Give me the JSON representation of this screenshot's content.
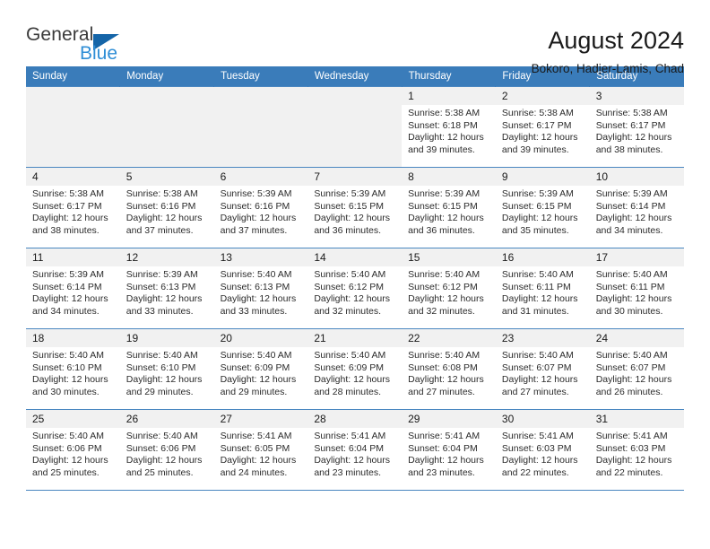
{
  "brand": {
    "name_top": "General",
    "name_bottom": "Blue",
    "triangle_color": "#1565a8",
    "blue_color": "#2f8ed6"
  },
  "header": {
    "title": "August 2024",
    "location": "Bokoro, Hadjer-Lamis, Chad"
  },
  "theme": {
    "header_bg": "#3a7cba",
    "row_border": "#4a87c0",
    "daynum_bg": "#f1f1f1"
  },
  "calendar": {
    "weekdays": [
      "Sunday",
      "Monday",
      "Tuesday",
      "Wednesday",
      "Thursday",
      "Friday",
      "Saturday"
    ],
    "weeks": [
      [
        {
          "day": "",
          "sunrise": "",
          "sunset": "",
          "daylight_line1": "",
          "daylight_line2": "",
          "empty": true
        },
        {
          "day": "",
          "sunrise": "",
          "sunset": "",
          "daylight_line1": "",
          "daylight_line2": "",
          "empty": true
        },
        {
          "day": "",
          "sunrise": "",
          "sunset": "",
          "daylight_line1": "",
          "daylight_line2": "",
          "empty": true
        },
        {
          "day": "",
          "sunrise": "",
          "sunset": "",
          "daylight_line1": "",
          "daylight_line2": "",
          "empty": true
        },
        {
          "day": "1",
          "sunrise": "Sunrise: 5:38 AM",
          "sunset": "Sunset: 6:18 PM",
          "daylight_line1": "Daylight: 12 hours",
          "daylight_line2": "and 39 minutes.",
          "empty": false
        },
        {
          "day": "2",
          "sunrise": "Sunrise: 5:38 AM",
          "sunset": "Sunset: 6:17 PM",
          "daylight_line1": "Daylight: 12 hours",
          "daylight_line2": "and 39 minutes.",
          "empty": false
        },
        {
          "day": "3",
          "sunrise": "Sunrise: 5:38 AM",
          "sunset": "Sunset: 6:17 PM",
          "daylight_line1": "Daylight: 12 hours",
          "daylight_line2": "and 38 minutes.",
          "empty": false
        }
      ],
      [
        {
          "day": "4",
          "sunrise": "Sunrise: 5:38 AM",
          "sunset": "Sunset: 6:17 PM",
          "daylight_line1": "Daylight: 12 hours",
          "daylight_line2": "and 38 minutes.",
          "empty": false
        },
        {
          "day": "5",
          "sunrise": "Sunrise: 5:38 AM",
          "sunset": "Sunset: 6:16 PM",
          "daylight_line1": "Daylight: 12 hours",
          "daylight_line2": "and 37 minutes.",
          "empty": false
        },
        {
          "day": "6",
          "sunrise": "Sunrise: 5:39 AM",
          "sunset": "Sunset: 6:16 PM",
          "daylight_line1": "Daylight: 12 hours",
          "daylight_line2": "and 37 minutes.",
          "empty": false
        },
        {
          "day": "7",
          "sunrise": "Sunrise: 5:39 AM",
          "sunset": "Sunset: 6:15 PM",
          "daylight_line1": "Daylight: 12 hours",
          "daylight_line2": "and 36 minutes.",
          "empty": false
        },
        {
          "day": "8",
          "sunrise": "Sunrise: 5:39 AM",
          "sunset": "Sunset: 6:15 PM",
          "daylight_line1": "Daylight: 12 hours",
          "daylight_line2": "and 36 minutes.",
          "empty": false
        },
        {
          "day": "9",
          "sunrise": "Sunrise: 5:39 AM",
          "sunset": "Sunset: 6:15 PM",
          "daylight_line1": "Daylight: 12 hours",
          "daylight_line2": "and 35 minutes.",
          "empty": false
        },
        {
          "day": "10",
          "sunrise": "Sunrise: 5:39 AM",
          "sunset": "Sunset: 6:14 PM",
          "daylight_line1": "Daylight: 12 hours",
          "daylight_line2": "and 34 minutes.",
          "empty": false
        }
      ],
      [
        {
          "day": "11",
          "sunrise": "Sunrise: 5:39 AM",
          "sunset": "Sunset: 6:14 PM",
          "daylight_line1": "Daylight: 12 hours",
          "daylight_line2": "and 34 minutes.",
          "empty": false
        },
        {
          "day": "12",
          "sunrise": "Sunrise: 5:39 AM",
          "sunset": "Sunset: 6:13 PM",
          "daylight_line1": "Daylight: 12 hours",
          "daylight_line2": "and 33 minutes.",
          "empty": false
        },
        {
          "day": "13",
          "sunrise": "Sunrise: 5:40 AM",
          "sunset": "Sunset: 6:13 PM",
          "daylight_line1": "Daylight: 12 hours",
          "daylight_line2": "and 33 minutes.",
          "empty": false
        },
        {
          "day": "14",
          "sunrise": "Sunrise: 5:40 AM",
          "sunset": "Sunset: 6:12 PM",
          "daylight_line1": "Daylight: 12 hours",
          "daylight_line2": "and 32 minutes.",
          "empty": false
        },
        {
          "day": "15",
          "sunrise": "Sunrise: 5:40 AM",
          "sunset": "Sunset: 6:12 PM",
          "daylight_line1": "Daylight: 12 hours",
          "daylight_line2": "and 32 minutes.",
          "empty": false
        },
        {
          "day": "16",
          "sunrise": "Sunrise: 5:40 AM",
          "sunset": "Sunset: 6:11 PM",
          "daylight_line1": "Daylight: 12 hours",
          "daylight_line2": "and 31 minutes.",
          "empty": false
        },
        {
          "day": "17",
          "sunrise": "Sunrise: 5:40 AM",
          "sunset": "Sunset: 6:11 PM",
          "daylight_line1": "Daylight: 12 hours",
          "daylight_line2": "and 30 minutes.",
          "empty": false
        }
      ],
      [
        {
          "day": "18",
          "sunrise": "Sunrise: 5:40 AM",
          "sunset": "Sunset: 6:10 PM",
          "daylight_line1": "Daylight: 12 hours",
          "daylight_line2": "and 30 minutes.",
          "empty": false
        },
        {
          "day": "19",
          "sunrise": "Sunrise: 5:40 AM",
          "sunset": "Sunset: 6:10 PM",
          "daylight_line1": "Daylight: 12 hours",
          "daylight_line2": "and 29 minutes.",
          "empty": false
        },
        {
          "day": "20",
          "sunrise": "Sunrise: 5:40 AM",
          "sunset": "Sunset: 6:09 PM",
          "daylight_line1": "Daylight: 12 hours",
          "daylight_line2": "and 29 minutes.",
          "empty": false
        },
        {
          "day": "21",
          "sunrise": "Sunrise: 5:40 AM",
          "sunset": "Sunset: 6:09 PM",
          "daylight_line1": "Daylight: 12 hours",
          "daylight_line2": "and 28 minutes.",
          "empty": false
        },
        {
          "day": "22",
          "sunrise": "Sunrise: 5:40 AM",
          "sunset": "Sunset: 6:08 PM",
          "daylight_line1": "Daylight: 12 hours",
          "daylight_line2": "and 27 minutes.",
          "empty": false
        },
        {
          "day": "23",
          "sunrise": "Sunrise: 5:40 AM",
          "sunset": "Sunset: 6:07 PM",
          "daylight_line1": "Daylight: 12 hours",
          "daylight_line2": "and 27 minutes.",
          "empty": false
        },
        {
          "day": "24",
          "sunrise": "Sunrise: 5:40 AM",
          "sunset": "Sunset: 6:07 PM",
          "daylight_line1": "Daylight: 12 hours",
          "daylight_line2": "and 26 minutes.",
          "empty": false
        }
      ],
      [
        {
          "day": "25",
          "sunrise": "Sunrise: 5:40 AM",
          "sunset": "Sunset: 6:06 PM",
          "daylight_line1": "Daylight: 12 hours",
          "daylight_line2": "and 25 minutes.",
          "empty": false
        },
        {
          "day": "26",
          "sunrise": "Sunrise: 5:40 AM",
          "sunset": "Sunset: 6:06 PM",
          "daylight_line1": "Daylight: 12 hours",
          "daylight_line2": "and 25 minutes.",
          "empty": false
        },
        {
          "day": "27",
          "sunrise": "Sunrise: 5:41 AM",
          "sunset": "Sunset: 6:05 PM",
          "daylight_line1": "Daylight: 12 hours",
          "daylight_line2": "and 24 minutes.",
          "empty": false
        },
        {
          "day": "28",
          "sunrise": "Sunrise: 5:41 AM",
          "sunset": "Sunset: 6:04 PM",
          "daylight_line1": "Daylight: 12 hours",
          "daylight_line2": "and 23 minutes.",
          "empty": false
        },
        {
          "day": "29",
          "sunrise": "Sunrise: 5:41 AM",
          "sunset": "Sunset: 6:04 PM",
          "daylight_line1": "Daylight: 12 hours",
          "daylight_line2": "and 23 minutes.",
          "empty": false
        },
        {
          "day": "30",
          "sunrise": "Sunrise: 5:41 AM",
          "sunset": "Sunset: 6:03 PM",
          "daylight_line1": "Daylight: 12 hours",
          "daylight_line2": "and 22 minutes.",
          "empty": false
        },
        {
          "day": "31",
          "sunrise": "Sunrise: 5:41 AM",
          "sunset": "Sunset: 6:03 PM",
          "daylight_line1": "Daylight: 12 hours",
          "daylight_line2": "and 22 minutes.",
          "empty": false
        }
      ]
    ]
  }
}
